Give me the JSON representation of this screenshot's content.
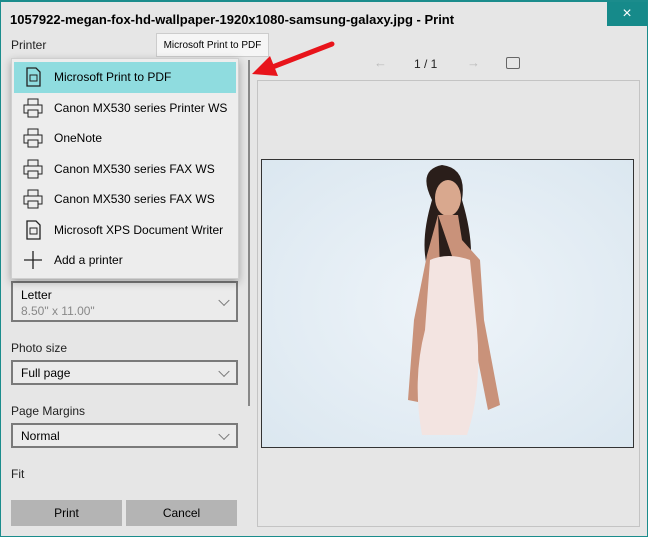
{
  "window": {
    "title": "1057922-megan-fox-hd-wallpaper-1920x1080-samsung-galaxy.jpg - Print",
    "close_icon": "×"
  },
  "printer": {
    "label": "Printer",
    "tooltip": "Microsoft Print to PDF",
    "options": [
      {
        "label": "Microsoft Print to PDF",
        "icon": "pdf-printer-icon",
        "selected": true
      },
      {
        "label": "Canon MX530 series Printer WS",
        "icon": "printer-icon"
      },
      {
        "label": "OneNote",
        "icon": "printer-icon"
      },
      {
        "label": "Canon MX530 series FAX WS",
        "icon": "printer-icon"
      },
      {
        "label": "Canon MX530 series FAX WS",
        "icon": "printer-icon"
      },
      {
        "label": "Microsoft XPS Document Writer",
        "icon": "document-printer-icon"
      },
      {
        "label": "Add a printer",
        "icon": "plus-icon"
      }
    ]
  },
  "paper": {
    "name": "Letter",
    "size": "8.50\" x 11.00\""
  },
  "photo_size": {
    "label": "Photo size",
    "value": "Full page"
  },
  "margins": {
    "label": "Page Margins",
    "value": "Normal"
  },
  "fit": {
    "label": "Fit"
  },
  "preview": {
    "page": "1 / 1",
    "prev": "←",
    "next": "→"
  },
  "buttons": {
    "print": "Print",
    "cancel": "Cancel"
  },
  "colors": {
    "accent": "#168a8a",
    "highlight": "#8fdcdf",
    "arrow": "#e8141b"
  }
}
